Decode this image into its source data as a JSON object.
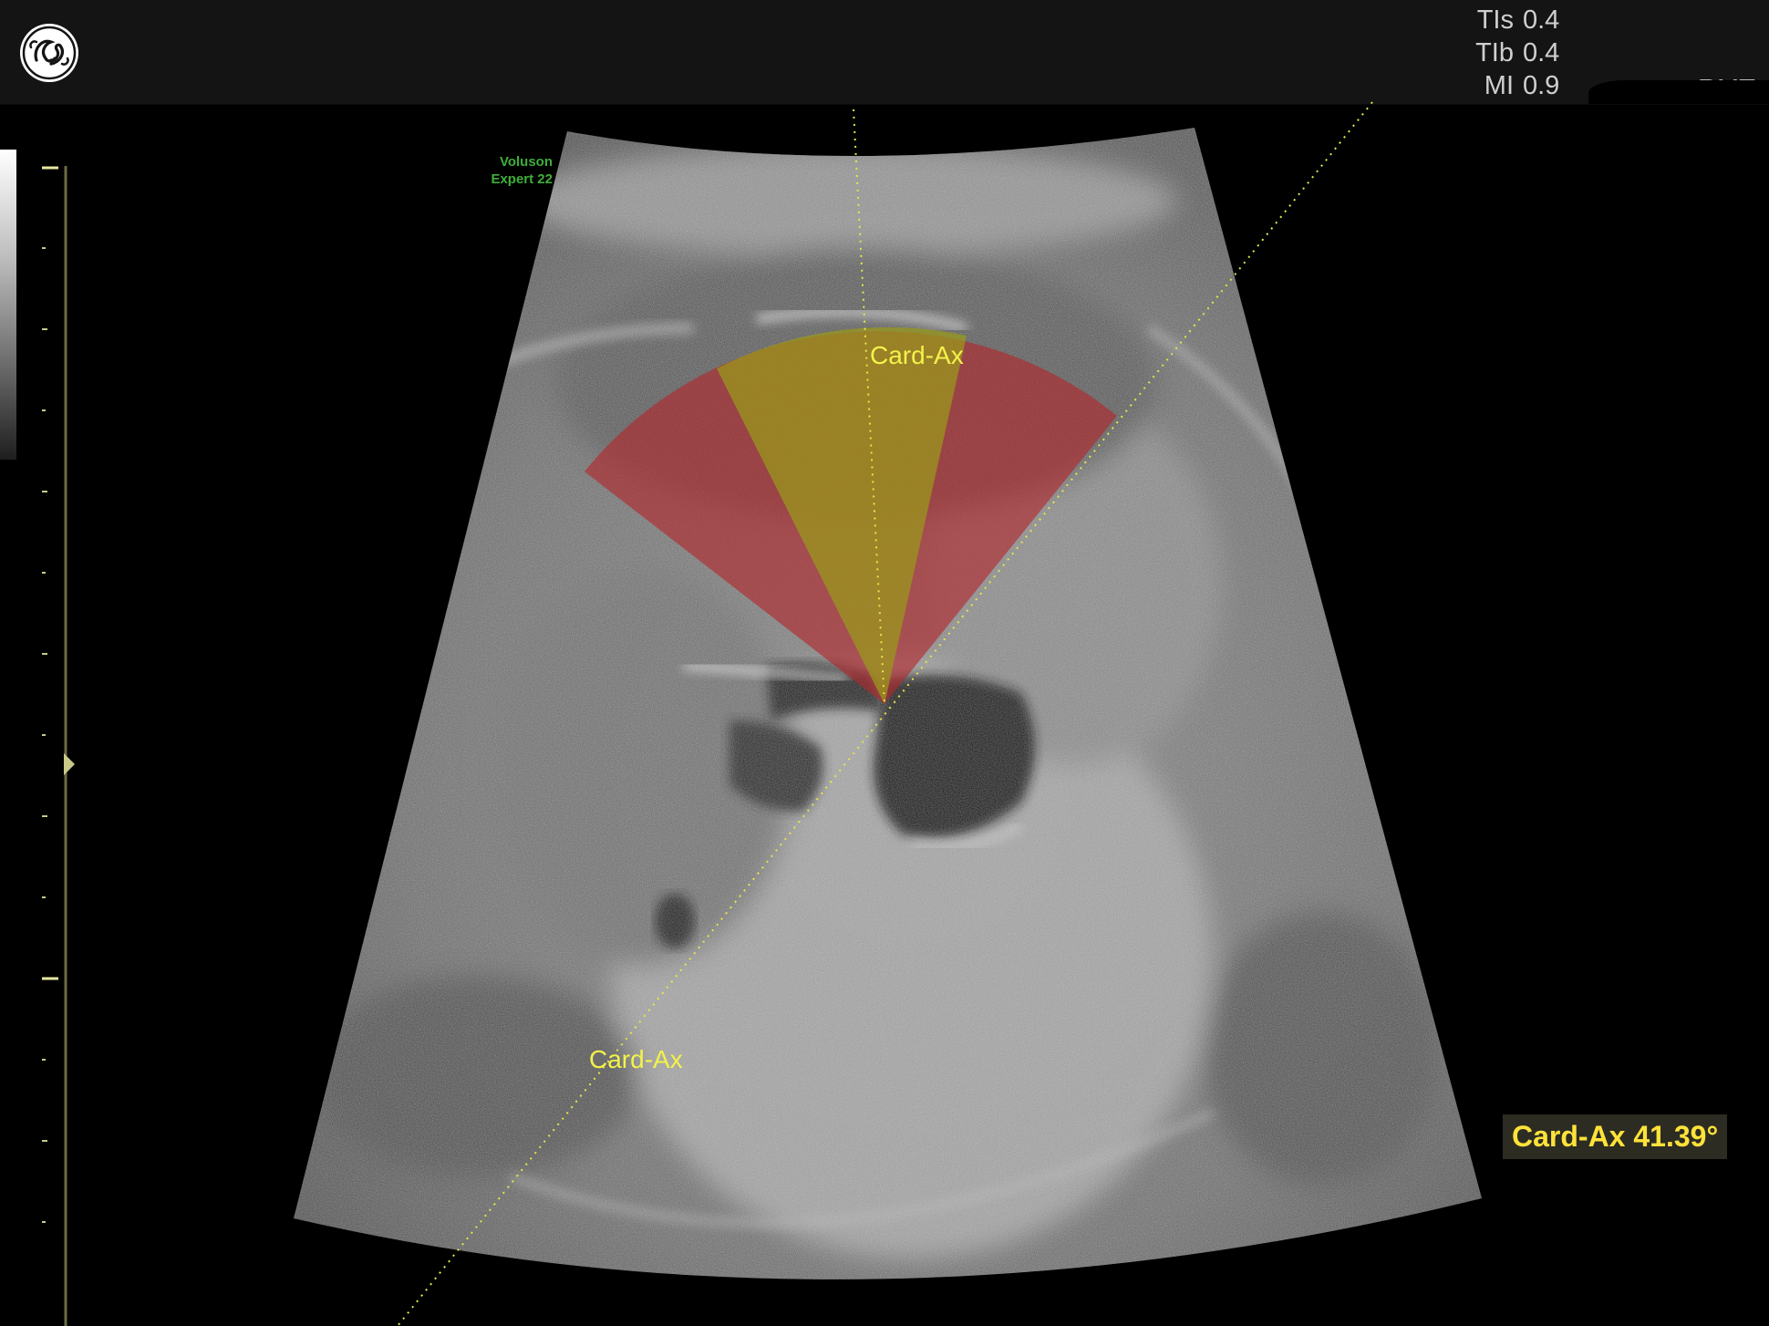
{
  "header": {
    "logo": "ge-logo",
    "acoustic_readouts": [
      {
        "label": "TIs",
        "value": "0.4"
      },
      {
        "label": "TIb",
        "value": "0.4"
      },
      {
        "label": "MI",
        "value": "0.9"
      }
    ],
    "clipped_label": "RMT"
  },
  "image_area": {
    "model_name_line1": "Voluson",
    "model_name_line2": "Expert 22",
    "plane_label_top": "Card-Ax",
    "plane_label_bottom": "Card-Ax",
    "angle_readout": "Card-Ax 41.39°"
  },
  "colors": {
    "overlay_red": "#b3262b",
    "overlay_green": "#9a9a1a",
    "annotation_yellow": "#f2f24a",
    "readout_yellow": "#ffe23a",
    "model_name_green": "#3fae3a"
  }
}
